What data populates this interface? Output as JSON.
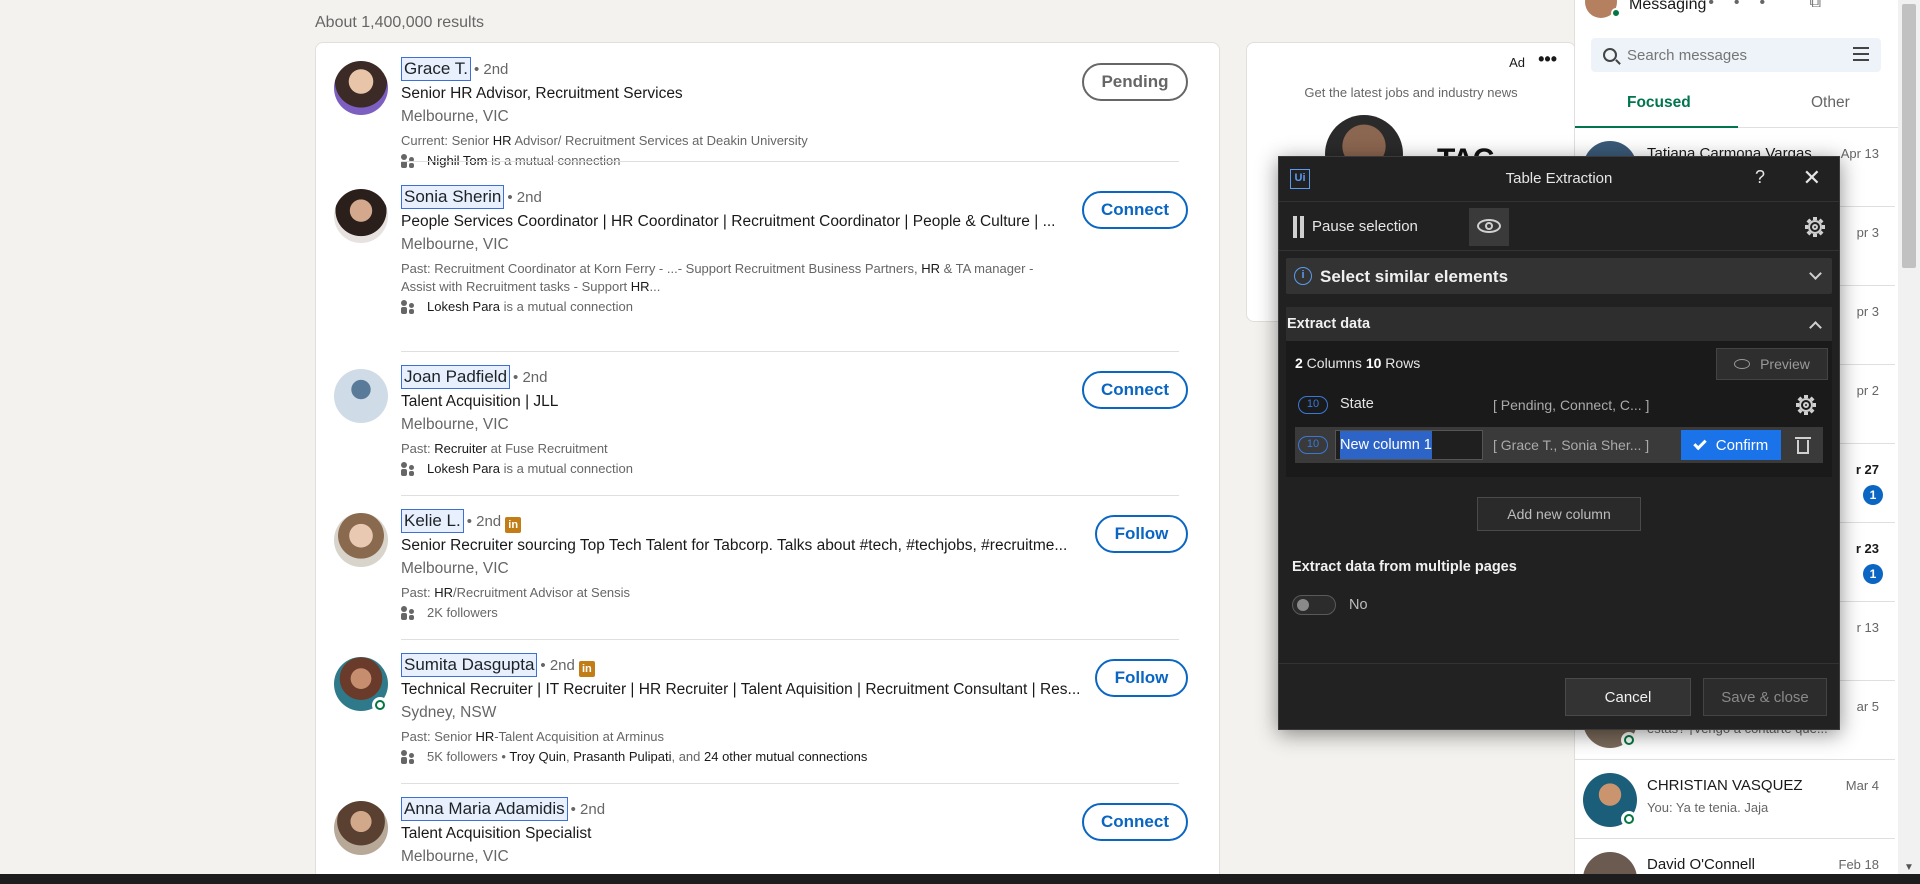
{
  "search": {
    "results_count": "About 1,400,000 results"
  },
  "results": [
    {
      "name": "Grace T.",
      "degree": "• 2nd",
      "headline": "Senior HR Advisor, Recruitment Services",
      "location": "Melbourne, VIC",
      "summary_pre": "Current: Senior ",
      "summary_bold": "HR",
      "summary_post": " Advisor/ Recruitment Services at Deakin University",
      "mutual_name": "Nighil Tom",
      "mutual_text": " is a mutual connection",
      "action": "Pending",
      "avatar_color": "#3b2a25"
    },
    {
      "name": "Sonia Sherin",
      "degree": "• 2nd",
      "headline": "People Services Coordinator | HR Coordinator | Recruitment Coordinator | People & Culture | ...",
      "location": "Melbourne, VIC",
      "summary_pre": "Past: Recruitment Coordinator at Korn Ferry - ...- Support Recruitment Business Partners, ",
      "summary_bold": "HR",
      "summary_post": " & TA manager - Assist with Recruitment tasks - Support ",
      "summary_bold2": "HR",
      "summary_post2": "...",
      "mutual_name": "Lokesh Para",
      "mutual_text": " is a mutual connection",
      "action": "Connect",
      "avatar_color": "#4a3a35"
    },
    {
      "name": "Joan Padfield",
      "degree": "• 2nd",
      "headline": "Talent Acquisition | JLL",
      "location": "Melbourne, VIC",
      "summary_pre": "Past: ",
      "summary_bold": "Recruiter",
      "summary_post": " at Fuse Recruitment",
      "mutual_name": "Lokesh Para",
      "mutual_text": " is a mutual connection",
      "action": "Connect",
      "avatar_color": "#9db3c8"
    },
    {
      "name": "Kelie L.",
      "degree": "• 2nd",
      "badge": "in",
      "headline": "Senior Recruiter sourcing Top Tech Talent for Tabcorp. Talks about #tech, #techjobs, #recruitme...",
      "location": "Melbourne, VIC",
      "summary_pre": "Past: ",
      "summary_bold": "HR",
      "summary_post": "/Recruitment Advisor at Sensis",
      "mutual_name": "",
      "mutual_text": "2K followers",
      "action": "Follow",
      "avatar_color": "#c7a690"
    },
    {
      "name": "Sumita Dasgupta",
      "degree": "• 2nd",
      "badge": "in",
      "headline": "Technical Recruiter | IT Recruiter | HR Recruiter | Talent Aquisition | Recruitment Consultant | Res...",
      "location": "Sydney, NSW",
      "summary_pre": "Past: Senior ",
      "summary_bold": "HR",
      "summary_post": "-Talent Acquisition at Arminus",
      "mutual_pre": "5K followers • ",
      "mutual_name": "Troy Quin",
      "mutual_sep": ", ",
      "mutual_name2": "Prasanth Pulipati",
      "mutual_and": ", and ",
      "mutual_name3": "24 other mutual connections",
      "action": "Follow",
      "avatar_color": "#7a4a3a"
    },
    {
      "name": "Anna Maria Adamidis",
      "degree": "• 2nd",
      "headline": "Talent Acquisition Specialist",
      "location": "Melbourne, VIC",
      "action": "Connect",
      "avatar_color": "#5a4030"
    }
  ],
  "ad": {
    "label": "Ad",
    "more": "•••",
    "text": "Get the latest jobs and industry news",
    "logo": "TAC"
  },
  "messaging": {
    "title": "Messaging",
    "head_icons": "••• ⧉ ⌃",
    "search_placeholder": "Search messages",
    "tab_focused": "Focused",
    "tab_other": "Other",
    "conversations": [
      {
        "name": "Tatiana Carmona Vargas",
        "date": "Apr 13",
        "preview": "",
        "color": "#3a5a78"
      },
      {
        "name": "",
        "date": "pr 3",
        "preview": "",
        "color": "#4a6a8a"
      },
      {
        "name": "",
        "date": "pr 3",
        "preview": "",
        "color": "#5a4a6a"
      },
      {
        "name": "",
        "date": "pr 2",
        "preview": "",
        "color": "#6a5a4a"
      },
      {
        "name": "",
        "date": "r 27",
        "preview": "",
        "badge": "1",
        "color": "#4a4a4a"
      },
      {
        "name": "",
        "date": "r 23",
        "preview": "",
        "badge": "1",
        "color": "#5a5a5a"
      },
      {
        "name": "",
        "date": "r 13",
        "preview": "",
        "color": "#6a6a6a"
      },
      {
        "name": "",
        "date": "ar 5",
        "preview": "estás? ¡Vengo a contarte que...",
        "color": "#7a6a5a"
      },
      {
        "name": "CHRISTIAN VASQUEZ",
        "date": "Mar 4",
        "preview": "You: Ya te tenia. Jaja",
        "color": "#1b5e7a"
      },
      {
        "name": "David O'Connell",
        "date": "Feb 18",
        "preview": "",
        "color": "#6a5a50"
      }
    ]
  },
  "dialog": {
    "logo": "Ui",
    "title": "Table Extraction",
    "help": "?",
    "close": "✕",
    "pause_label": "Pause selection",
    "select_similar": "Select similar elements",
    "extract_data": "Extract data",
    "columns_count": "2",
    "columns_word": " Columns  ",
    "rows_count": "10",
    "rows_word": " Rows",
    "preview_label": "Preview",
    "columns": [
      {
        "count": "10",
        "name": "State",
        "preview": "[ Pending, Connect, C... ]"
      },
      {
        "count": "10",
        "name": "New column 1",
        "preview": "[ Grace T., Sonia Sher... ]"
      }
    ],
    "confirm_label": "Confirm",
    "add_column_label": "Add new column",
    "multi_pages_label": "Extract data from multiple pages",
    "multi_pages_value": "No",
    "cancel_label": "Cancel",
    "save_label": "Save & close",
    "accent": "#1a73e8"
  }
}
